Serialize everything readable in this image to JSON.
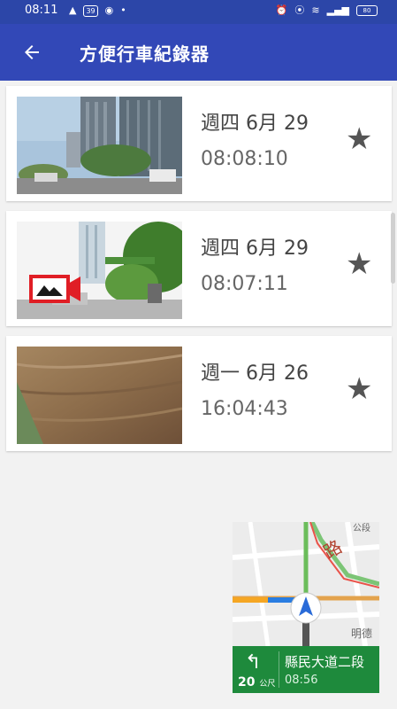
{
  "status_bar": {
    "time": "08:11",
    "badge_text": "39",
    "battery": "80",
    "left_icons": [
      "navigation-icon",
      "calendar-badge-icon",
      "camera-app-icon",
      "dot-icon"
    ],
    "right_icons": [
      "alarm-icon",
      "location-icon",
      "wifi-icon",
      "signal-icon",
      "battery-icon"
    ]
  },
  "app_bar": {
    "title": "方便行車紀錄器",
    "back_icon": "arrow-left-icon",
    "background": "#3248b7"
  },
  "recordings": [
    {
      "date": "週四 6月 29",
      "time": "08:08:10",
      "thumbnail": "city-street-buildings"
    },
    {
      "date": "週四 6月 29",
      "time": "08:07:11",
      "thumbnail": "street-intersection",
      "overlay_icon": "video-camera-icon"
    },
    {
      "date": "週一 6月 26",
      "time": "16:04:43",
      "thumbnail": "wooden-surface"
    }
  ],
  "nav_widget": {
    "street": "縣民大道二段",
    "distance": "20",
    "distance_unit": "公尺",
    "eta": "08:56",
    "map_label_top": "路",
    "map_label_right": "明德",
    "map_label_corner": "公段",
    "turn_icon": "turn-left-icon",
    "accent": "#1e8a3c"
  }
}
